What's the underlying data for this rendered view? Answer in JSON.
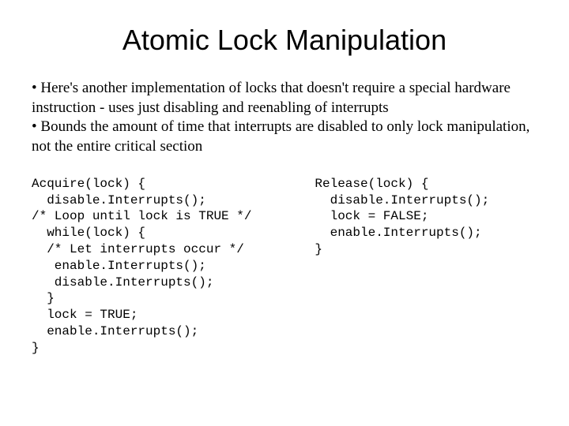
{
  "title": "Atomic Lock Manipulation",
  "bullets": {
    "b1": "• Here's another implementation of locks that doesn't require a special hardware instruction - uses just disabling and reenabling of interrupts",
    "b2": "• Bounds the amount of time that interrupts are disabled to only lock manipulation, not the entire critical section"
  },
  "code": {
    "acquire": "Acquire(lock) {\n  disable.Interrupts();\n/* Loop until lock is TRUE */\n  while(lock) {\n  /* Let interrupts occur */\n   enable.Interrupts();\n   disable.Interrupts();\n  }\n  lock = TRUE;\n  enable.Interrupts();\n}",
    "release": "Release(lock) {\n  disable.Interrupts();\n  lock = FALSE;\n  enable.Interrupts();\n}"
  }
}
